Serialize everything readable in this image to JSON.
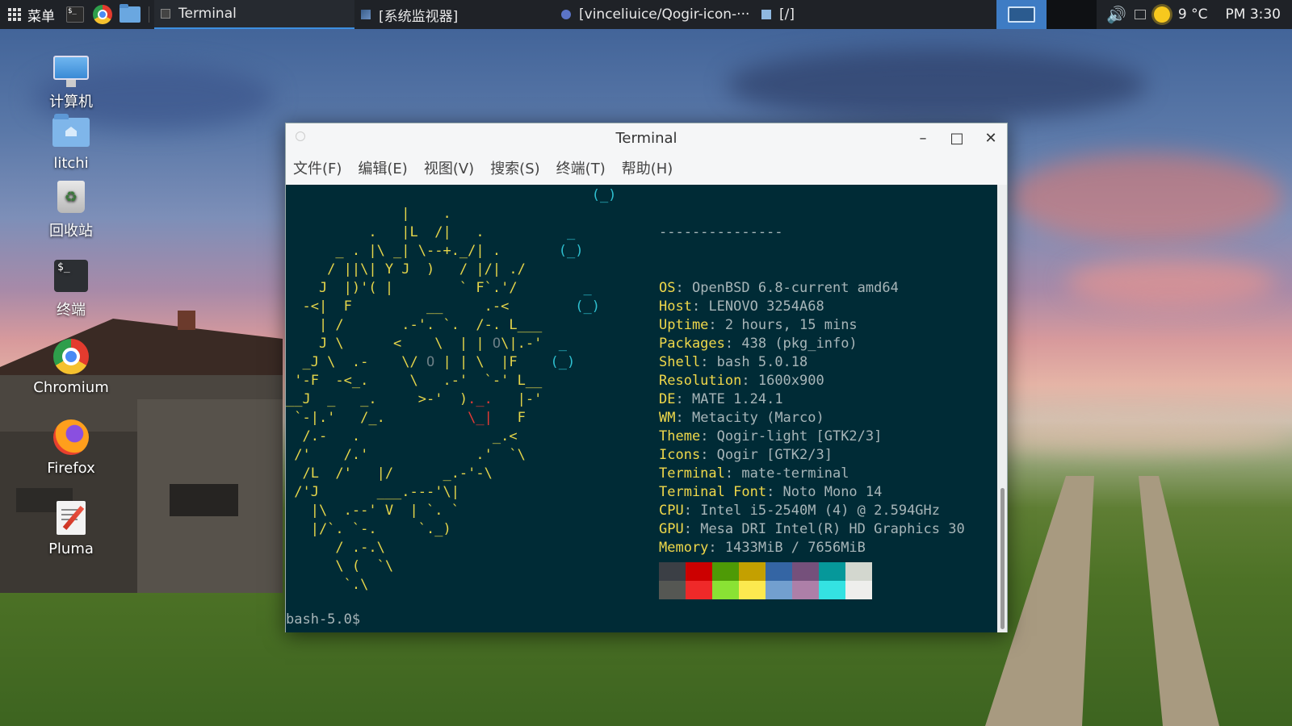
{
  "panel": {
    "menu_label": "菜单",
    "tasks": [
      "Terminal",
      "[系统监视器]",
      "[vinceliuice/Qogir-icon-···",
      "[/]"
    ],
    "temperature": "9 °C",
    "clock": "PM 3:30"
  },
  "desktop": {
    "icons": [
      "计算机",
      "litchi",
      "回收站",
      "终端",
      "Chromium",
      "Firefox",
      "Pluma"
    ]
  },
  "window": {
    "title": "Terminal",
    "menu": [
      "文件(F)",
      "编辑(E)",
      "视图(V)",
      "搜索(S)",
      "终端(T)",
      "帮助(H)"
    ]
  },
  "terminal": {
    "divider": "---------------",
    "info": [
      {
        "key": "OS",
        "value": "OpenBSD 6.8-current amd64"
      },
      {
        "key": "Host",
        "value": "LENOVO 3254A68"
      },
      {
        "key": "Uptime",
        "value": "2 hours, 15 mins"
      },
      {
        "key": "Packages",
        "value": "438 (pkg_info)"
      },
      {
        "key": "Shell",
        "value": "bash 5.0.18"
      },
      {
        "key": "Resolution",
        "value": "1600x900"
      },
      {
        "key": "DE",
        "value": "MATE 1.24.1"
      },
      {
        "key": "WM",
        "value": "Metacity (Marco)"
      },
      {
        "key": "Theme",
        "value": "Qogir-light [GTK2/3]"
      },
      {
        "key": "Icons",
        "value": "Qogir [GTK2/3]"
      },
      {
        "key": "Terminal",
        "value": "mate-terminal"
      },
      {
        "key": "Terminal Font",
        "value": "Noto Mono 14"
      },
      {
        "key": "CPU",
        "value": "Intel i5-2540M (4) @ 2.594GHz"
      },
      {
        "key": "GPU",
        "value": "Mesa DRI Intel(R) HD Graphics 30"
      },
      {
        "key": "Memory",
        "value": "1433MiB / 7656MiB"
      }
    ],
    "palette": [
      "#3b3f45",
      "#cc0000",
      "#4e9a06",
      "#c4a000",
      "#3465a4",
      "#75507b",
      "#06989a",
      "#d3d7cf",
      "#555753",
      "#ef2929",
      "#8ae234",
      "#fce94f",
      "#729fcf",
      "#ad7fa8",
      "#34e2e2",
      "#eeeeec"
    ],
    "prompt": "bash-5.0$"
  }
}
